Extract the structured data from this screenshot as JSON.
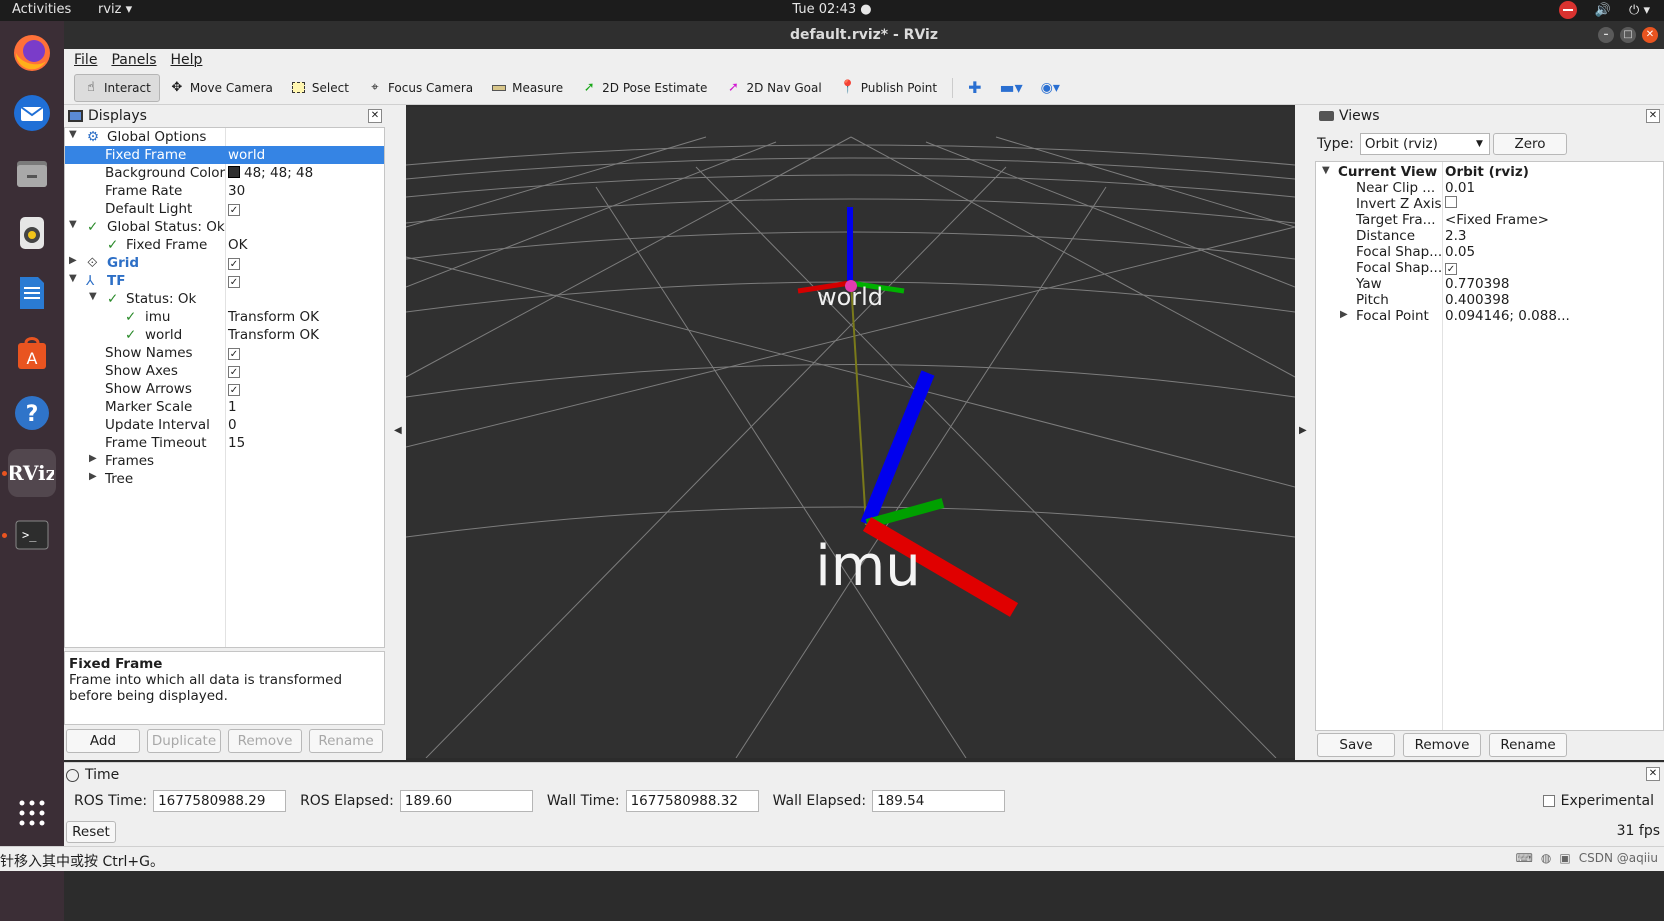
{
  "topbar": {
    "activities": "Activities",
    "app": "rviz ▾",
    "clock": "Tue 02:43 ●"
  },
  "dock": {
    "items": [
      "Firefox",
      "Thunderbird",
      "Files",
      "Rhythmbox",
      "LibreOffice Writer",
      "Ubuntu Software",
      "Help",
      "RViz",
      "Terminal"
    ]
  },
  "window": {
    "title": "default.rviz* - RViz"
  },
  "menu": {
    "file": "File",
    "panels": "Panels",
    "help": "Help"
  },
  "toolbar": {
    "interact": "Interact",
    "move_camera": "Move Camera",
    "select": "Select",
    "focus_camera": "Focus Camera",
    "measure": "Measure",
    "pose_estimate": "2D Pose Estimate",
    "nav_goal": "2D Nav Goal",
    "publish_point": "Publish Point"
  },
  "displays": {
    "title": "Displays",
    "rows": [
      {
        "k": "Global Options",
        "v": ""
      },
      {
        "k": "Fixed Frame",
        "v": "world"
      },
      {
        "k": "Background Color",
        "v": "48; 48; 48"
      },
      {
        "k": "Frame Rate",
        "v": "30"
      },
      {
        "k": "Default Light",
        "v": "✓"
      },
      {
        "k": "Global Status: Ok",
        "v": ""
      },
      {
        "k": "Fixed Frame",
        "v": "OK"
      },
      {
        "k": "Grid",
        "v": "✓"
      },
      {
        "k": "TF",
        "v": "✓"
      },
      {
        "k": "Status: Ok",
        "v": ""
      },
      {
        "k": "imu",
        "v": "Transform OK"
      },
      {
        "k": "world",
        "v": "Transform OK"
      },
      {
        "k": "Show Names",
        "v": "✓"
      },
      {
        "k": "Show Axes",
        "v": "✓"
      },
      {
        "k": "Show Arrows",
        "v": "✓"
      },
      {
        "k": "Marker Scale",
        "v": "1"
      },
      {
        "k": "Update Interval",
        "v": "0"
      },
      {
        "k": "Frame Timeout",
        "v": "15"
      },
      {
        "k": "Frames",
        "v": ""
      },
      {
        "k": "Tree",
        "v": ""
      }
    ],
    "desc_title": "Fixed Frame",
    "desc_text": "Frame into which all data is transformed before being displayed.",
    "buttons": {
      "add": "Add",
      "duplicate": "Duplicate",
      "remove": "Remove",
      "rename": "Rename"
    }
  },
  "viewport": {
    "label_world": "world",
    "label_imu": "imu"
  },
  "views": {
    "title": "Views",
    "type_label": "Type:",
    "type_value": "Orbit (rviz)",
    "zero": "Zero",
    "rows": [
      {
        "k": "Current View",
        "v": "Orbit (rviz)"
      },
      {
        "k": "Near Clip ...",
        "v": "0.01"
      },
      {
        "k": "Invert Z Axis",
        "v": ""
      },
      {
        "k": "Target Fra...",
        "v": "<Fixed Frame>"
      },
      {
        "k": "Distance",
        "v": "2.3"
      },
      {
        "k": "Focal Shap...",
        "v": "0.05"
      },
      {
        "k": "Focal Shap...",
        "v": "✓"
      },
      {
        "k": "Yaw",
        "v": "0.770398"
      },
      {
        "k": "Pitch",
        "v": "0.400398"
      },
      {
        "k": "Focal Point",
        "v": "0.094146; 0.088..."
      }
    ],
    "buttons": {
      "save": "Save",
      "remove": "Remove",
      "rename": "Rename"
    }
  },
  "time": {
    "title": "Time",
    "ros_time_label": "ROS Time:",
    "ros_time": "1677580988.29",
    "ros_elapsed_label": "ROS Elapsed:",
    "ros_elapsed": "189.60",
    "wall_time_label": "Wall Time:",
    "wall_time": "1677580988.32",
    "wall_elapsed_label": "Wall Elapsed:",
    "wall_elapsed": "189.54",
    "experimental": "Experimental",
    "reset": "Reset",
    "fps": "31 fps"
  },
  "status": {
    "message": "针移入其中或按 Ctrl+G。",
    "watermark": "CSDN @aqiiu"
  },
  "colors": {
    "accent": "#3584e4",
    "viewport_bg": "#303030",
    "x_axis": "#e00000",
    "y_axis": "#00b000",
    "z_axis": "#0000ee"
  }
}
